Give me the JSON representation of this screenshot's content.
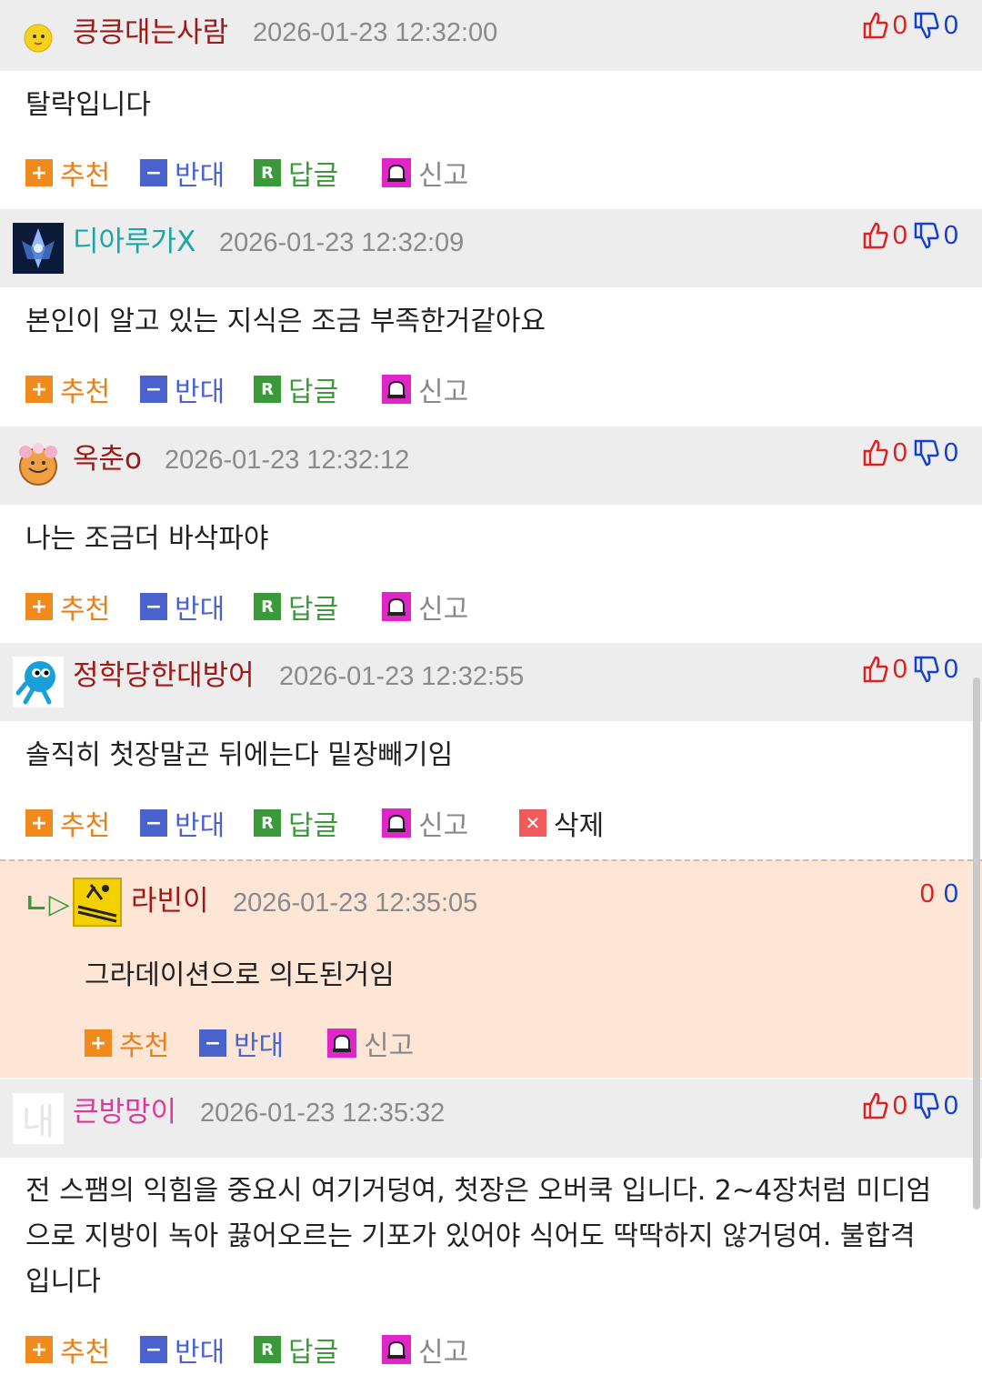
{
  "actions": {
    "recommend": "추천",
    "oppose": "반대",
    "reply": "답글",
    "report": "신고",
    "delete": "삭제"
  },
  "comments": [
    {
      "nickname": "킁킁대는사람",
      "nick_color": "#a01818",
      "date": "2026-01-23 12:32:00",
      "up": "0",
      "down": "0",
      "text": "탈락입니다"
    },
    {
      "nickname": "디아루가X",
      "nick_color": "#1aa6a6",
      "date": "2026-01-23 12:32:09",
      "up": "0",
      "down": "0",
      "text": "본인이 알고 있는 지식은 조금 부족한거같아요"
    },
    {
      "nickname": "옥춘o",
      "nick_color": "#a01818",
      "date": "2026-01-23 12:32:12",
      "up": "0",
      "down": "0",
      "text": "나는 조금더 바삭파야"
    },
    {
      "nickname": "정학당한대방어",
      "nick_color": "#a01818",
      "date": "2026-01-23 12:32:55",
      "up": "0",
      "down": "0",
      "text": "솔직히 첫장말곤 뒤에는다 밑장빼기임"
    },
    {
      "nickname": "큰방망이",
      "nick_color": "#e0389a",
      "date": "2026-01-23 12:35:32",
      "up": "0",
      "down": "0",
      "text_lines": [
        "전 스팸의 익힘을 중요시 여기거덩여, 첫장은 오버쿡 입니다. 2~4장처럼 미디엄",
        "으로 지방이 녹아 끓어오르는 기포가 있어야 식어도 딱딱하지 않거덩여. 불합격",
        "입니다"
      ]
    }
  ],
  "reply": {
    "arrow": "ㄴ▷",
    "nickname": "라빈이",
    "nick_color": "#a01818",
    "date": "2026-01-23 12:35:05",
    "up": "0",
    "down": "0",
    "text": "그라데이션으로 의도된거임"
  },
  "avatar_text": "내"
}
